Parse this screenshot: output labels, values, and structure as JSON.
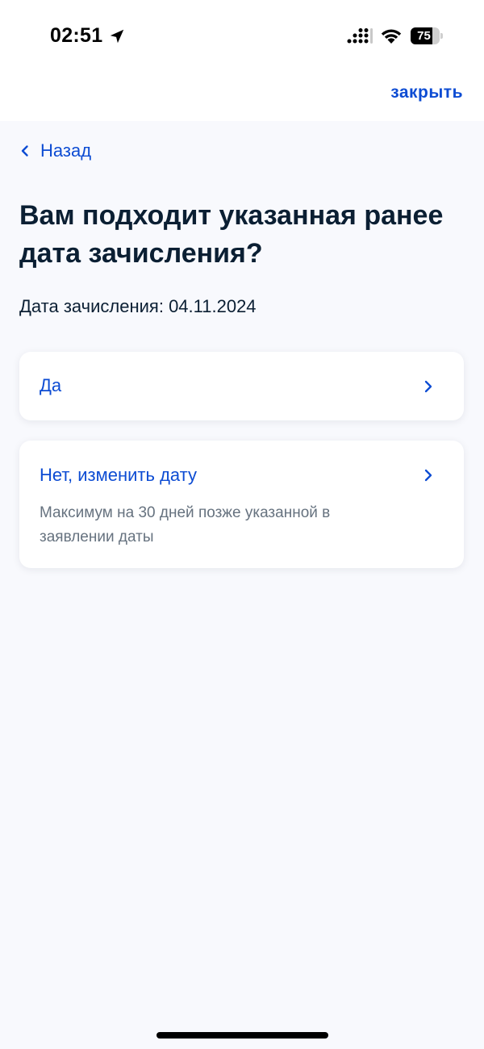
{
  "status_bar": {
    "time": "02:51",
    "battery_percent": "75",
    "battery_level": 0.75,
    "icons": [
      "location-arrow-icon",
      "cellular-signal-icon",
      "wifi-icon",
      "battery-icon"
    ]
  },
  "header": {
    "close_label": "закрыть"
  },
  "nav": {
    "back_label": "Назад"
  },
  "main": {
    "title": "Вам подходит указанная ранее дата зачисления?",
    "date_text": "Дата зачисления: 04.11.2024",
    "options": [
      {
        "label": "Да",
        "description": ""
      },
      {
        "label": "Нет, изменить дату",
        "description": "Максимум на 30 дней позже указанной в заявлении даты"
      }
    ]
  },
  "colors": {
    "accent": "#0d4cd3",
    "text_primary": "#0b1f33",
    "text_secondary": "#66727f",
    "background": "#f8f9fd"
  }
}
